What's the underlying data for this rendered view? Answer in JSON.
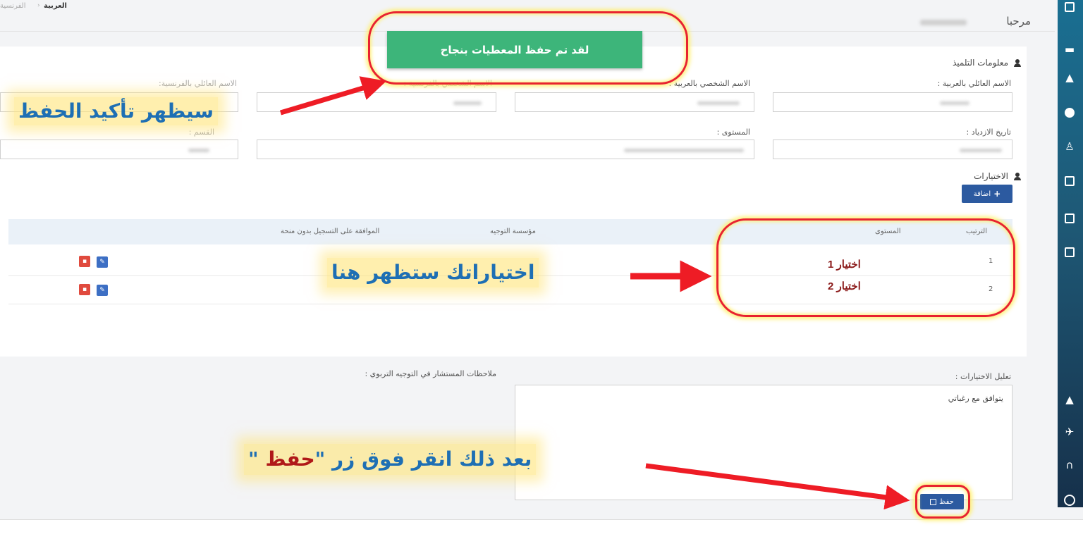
{
  "header": {
    "lang_arabic": "العربية",
    "lang_french": "الفرنسية",
    "lang_separator": "›",
    "welcome": "مرحبا"
  },
  "toast": {
    "message": "لقد تم حفظ المعطيات بنجاح"
  },
  "student_info": {
    "title": "معلومات التلميذ",
    "labels": {
      "family_name_ar": "الاسم العائلي بالعربية :",
      "first_name_ar": "الاسم الشخصي بالعربية :",
      "first_name_fr": "الاسم الشخصي بالفرنسية :",
      "family_name_fr": "الاسم العائلي بالفرنسية:",
      "birth_date": "تاريخ الازدياد :",
      "level": "المستوى :",
      "section": "القسم :"
    }
  },
  "choices": {
    "title": "الاختيارات",
    "add_button": "اضافة",
    "add_icon": "plus-icon",
    "columns": [
      "الترتيب",
      "المستوى",
      "مؤسسة التوجيه",
      "الموافقة على التسجيل بدون منحة"
    ],
    "rows": [
      {
        "order": "1",
        "level": "اختيار 1"
      },
      {
        "order": "2",
        "level": "اختيار 2"
      }
    ]
  },
  "justification": {
    "label": "تعليل الاختيارات :",
    "text": "يتوافق مع رغباتي"
  },
  "counselor_notes": {
    "label": "ملاحظات المستشار في التوجيه التربوي :"
  },
  "save_button": {
    "label": "حفظ",
    "icon": "save-disk-icon"
  },
  "annotations": {
    "save_confirmation": "سيظهر تأكيد الحفظ",
    "choices_here": "اختياراتك ستظهر هنا",
    "click_save_prefix": "بعد ذلك انقر فوق زر \"",
    "click_save_word": "حفظ",
    "click_save_suffix": " \""
  },
  "colors": {
    "sidebar": "#1e5875",
    "toast": "#3db57a",
    "primary_button": "#2c5aa0",
    "delete_button": "#e04a3e",
    "highlight_outline": "#e8232f",
    "callout_text": "#1e6fb4",
    "choice_text": "#8b1a1a"
  },
  "nav_icons": [
    "dashboard-icon",
    "book-icon",
    "school-icon",
    "compass-icon",
    "graduation-icon",
    "calendar-icon",
    "calendar-icon",
    "calendar-icon",
    "bell-icon",
    "plane-icon",
    "headset-icon",
    "user-circle-icon"
  ]
}
